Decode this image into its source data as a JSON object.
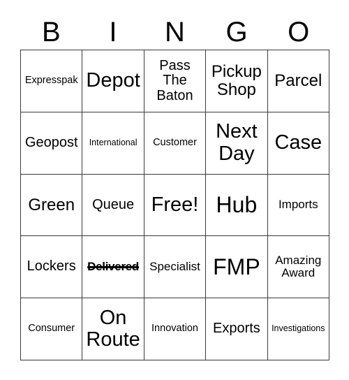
{
  "card": {
    "title": "Bingo Card",
    "header_letters": [
      "B",
      "I",
      "N",
      "G",
      "O"
    ],
    "grid_size": "5x5",
    "free_space_label": "Free!",
    "colors": {
      "text": "#000000",
      "grid_line": "#3a3a3a",
      "background": "#ffffff"
    },
    "rows": [
      {
        "cells": [
          {
            "label": "Expresspak",
            "size": "fs-sm",
            "marked": false
          },
          {
            "label": "Depot",
            "size": "fs-xxl",
            "marked": false
          },
          {
            "label": "Pass\nThe\nBaton",
            "size": "fs-lg",
            "marked": false
          },
          {
            "label": "Pickup\nShop",
            "size": "fs-xl",
            "marked": false
          },
          {
            "label": "Parcel",
            "size": "fs-xl",
            "marked": false
          }
        ]
      },
      {
        "cells": [
          {
            "label": "Geopost",
            "size": "fs-lg",
            "marked": false
          },
          {
            "label": "International",
            "size": "fs-xs",
            "marked": false
          },
          {
            "label": "Customer",
            "size": "fs-sm",
            "marked": false
          },
          {
            "label": "Next\nDay",
            "size": "fs-xxl",
            "marked": false
          },
          {
            "label": "Case",
            "size": "fs-xxl",
            "marked": false
          }
        ]
      },
      {
        "cells": [
          {
            "label": "Green",
            "size": "fs-xl",
            "marked": false
          },
          {
            "label": "Queue",
            "size": "fs-lg",
            "marked": false
          },
          {
            "label": "Free!",
            "size": "fs-xxl",
            "marked": false
          },
          {
            "label": "Hub",
            "size": "fs-3xl",
            "marked": false
          },
          {
            "label": "Imports",
            "size": "fs-md",
            "marked": false
          }
        ]
      },
      {
        "cells": [
          {
            "label": "Lockers",
            "size": "fs-lg",
            "marked": false
          },
          {
            "label": "Delivered",
            "size": "fs-md",
            "marked": true
          },
          {
            "label": "Specialist",
            "size": "fs-md",
            "marked": false
          },
          {
            "label": "FMP",
            "size": "fs-3xl",
            "marked": false
          },
          {
            "label": "Amazing\nAward",
            "size": "fs-md",
            "marked": false
          }
        ]
      },
      {
        "cells": [
          {
            "label": "Consumer",
            "size": "fs-sm",
            "marked": false
          },
          {
            "label": "On\nRoute",
            "size": "fs-xxl",
            "marked": false
          },
          {
            "label": "Innovation",
            "size": "fs-sm",
            "marked": false
          },
          {
            "label": "Exports",
            "size": "fs-lg",
            "marked": false
          },
          {
            "label": "Investigations",
            "size": "fs-xs",
            "marked": false
          }
        ]
      }
    ]
  }
}
